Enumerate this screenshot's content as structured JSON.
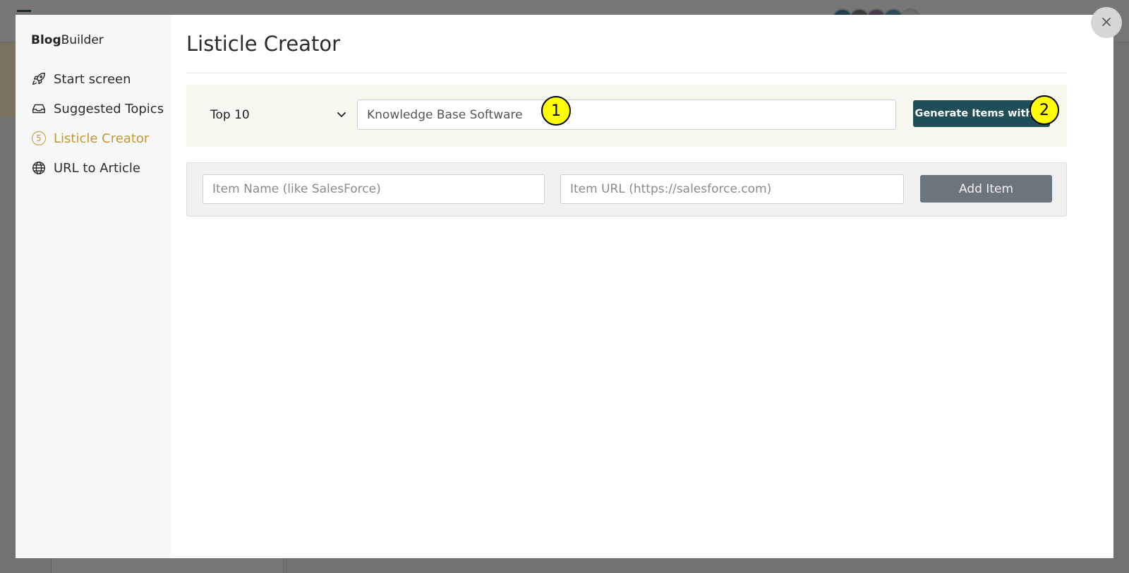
{
  "app": {
    "brand_bold": "Blog",
    "brand_rest": "Builder"
  },
  "sidebar": {
    "items": [
      {
        "label": "Start screen",
        "icon": "rocket-icon",
        "active": false
      },
      {
        "label": "Suggested Topics",
        "icon": "inbox-icon",
        "active": false
      },
      {
        "label": "Listicle Creator",
        "icon": "number-5-icon",
        "icon_text": "5",
        "active": true
      },
      {
        "label": "URL to Article",
        "icon": "globe-icon",
        "active": false
      }
    ]
  },
  "main": {
    "title": "Listicle Creator",
    "generator": {
      "count_value": "Top 10",
      "topic_value": "Knowledge Base Software",
      "generate_label": "Generate Items with AI"
    },
    "add_item": {
      "name_placeholder": "Item Name (like SalesForce)",
      "url_placeholder": "Item URL (https://salesforce.com)",
      "add_label": "Add Item"
    }
  },
  "callouts": [
    "1",
    "2"
  ],
  "colors": {
    "accent": "#c0973a",
    "primary_button": "#1f4e56",
    "secondary_button": "#6c757d",
    "callout": "#ffff00",
    "generator_panel": "#f7f6ef"
  }
}
